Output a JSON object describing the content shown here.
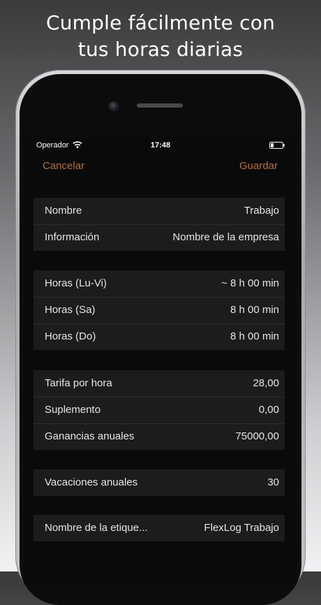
{
  "headline": {
    "line1": "Cumple fácilmente con",
    "line2": "tus horas diarias"
  },
  "status": {
    "carrier": "Operador",
    "time": "17:48"
  },
  "nav": {
    "cancel_label": "Cancelar",
    "save_label": "Guardar"
  },
  "colors": {
    "accent": "#b5703d",
    "background": "#0a0a0a",
    "cell": "#1c1c1e"
  },
  "sections": [
    {
      "rows": [
        {
          "label": "Nombre",
          "value": "Trabajo"
        },
        {
          "label": "Información",
          "value": "Nombre de la empresa"
        }
      ]
    },
    {
      "rows": [
        {
          "label": "Horas (Lu-Vi)",
          "value": "~ 8 h 00 min"
        },
        {
          "label": "Horas (Sa)",
          "value": "8 h 00 min"
        },
        {
          "label": "Horas (Do)",
          "value": "8 h 00 min"
        }
      ]
    },
    {
      "rows": [
        {
          "label": "Tarifa por hora",
          "value": "28,00"
        },
        {
          "label": "Suplemento",
          "value": "0,00"
        },
        {
          "label": "Ganancias anuales",
          "value": "75000,00"
        }
      ]
    },
    {
      "rows": [
        {
          "label": "Vacaciones anuales",
          "value": "30"
        }
      ]
    },
    {
      "rows": [
        {
          "label": "Nombre de la etique...",
          "value": "FlexLog Trabajo"
        }
      ]
    }
  ]
}
